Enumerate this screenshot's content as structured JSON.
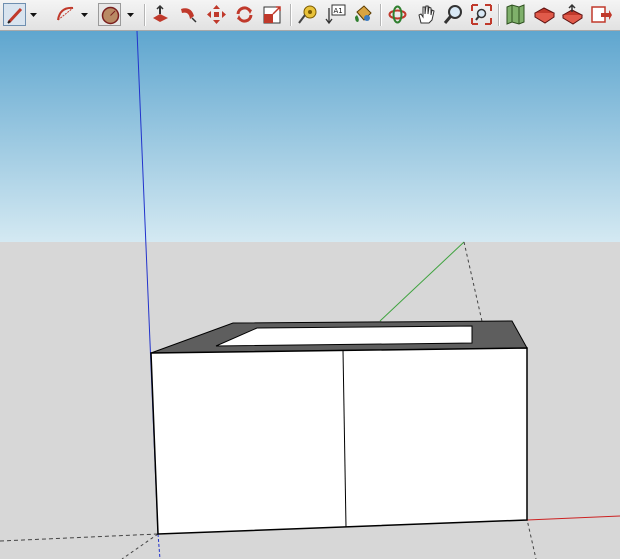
{
  "toolbar": {
    "tools": [
      {
        "name": "pencil-line-tool",
        "icon": "pencil-icon",
        "pressed": true
      },
      {
        "name": "arc-tool",
        "icon": "arc-icon"
      },
      {
        "name": "circle-tool",
        "icon": "circle-icon"
      },
      {
        "name": "push-pull-tool",
        "icon": "push-pull-icon"
      },
      {
        "name": "follow-me-tool",
        "icon": "follow-me-icon"
      },
      {
        "name": "move-tool",
        "icon": "move-icon"
      },
      {
        "name": "rotate-tool",
        "icon": "rotate-icon"
      },
      {
        "name": "scale-tool",
        "icon": "scale-icon"
      },
      {
        "name": "tape-measure-tool",
        "icon": "tape-measure-icon"
      },
      {
        "name": "text-tool",
        "icon": "text-label-icon",
        "label": "A1"
      },
      {
        "name": "paint-bucket-tool",
        "icon": "paint-bucket-icon"
      },
      {
        "name": "orbit-tool",
        "icon": "orbit-icon"
      },
      {
        "name": "pan-tool",
        "icon": "pan-hand-icon"
      },
      {
        "name": "zoom-tool",
        "icon": "zoom-icon"
      },
      {
        "name": "zoom-extents-tool",
        "icon": "zoom-extents-icon"
      },
      {
        "name": "map-tool",
        "icon": "map-icon"
      },
      {
        "name": "warehouse-get-models-tool",
        "icon": "warehouse-get-icon"
      },
      {
        "name": "share-model-tool",
        "icon": "share-model-icon"
      },
      {
        "name": "extension-warehouse-tool",
        "icon": "extension-icon"
      }
    ]
  },
  "colors": {
    "sky_top": "#5fa6cf",
    "sky_bottom": "#d4e9f2",
    "ground": "#d7d7d7",
    "axis_blue": "#2233cc",
    "axis_green": "#3fa33f",
    "axis_red": "#cc2222",
    "box_face": "#ffffff",
    "box_top": "#5e5e5e",
    "edge": "#000000"
  }
}
